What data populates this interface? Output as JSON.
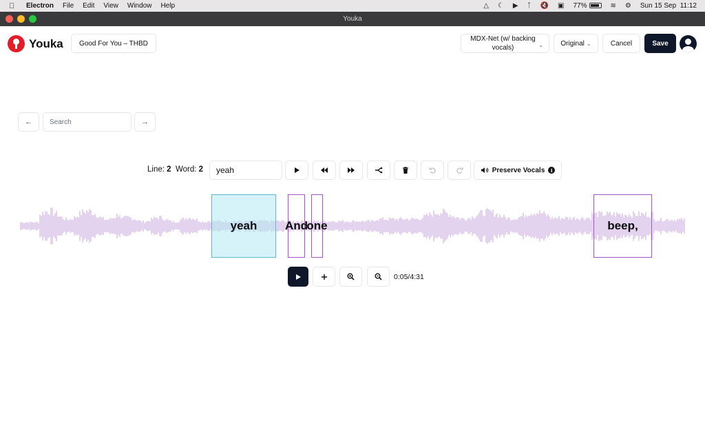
{
  "menubar": {
    "app_name": "Electron",
    "items": [
      "File",
      "Edit",
      "View",
      "Window",
      "Help"
    ],
    "battery": "77%",
    "date": "Sun 15 Sep",
    "time": "11:12"
  },
  "window": {
    "title": "Youka"
  },
  "header": {
    "logo_text": "Youka",
    "song": "Good For You – THBD",
    "model_select": "MDX-Net (w/ backing vocals)",
    "audio_select": "Original",
    "cancel_label": "Cancel",
    "save_label": "Save"
  },
  "search": {
    "placeholder": "Search"
  },
  "editor": {
    "line_label": "Line:",
    "line_value": "2",
    "word_label": "Word:",
    "word_value": "2",
    "word_text": "yeah",
    "preserve_label": "Preserve Vocals"
  },
  "waveform": {
    "color": "#c9a7dc",
    "words": [
      {
        "text": "yeah",
        "active": true
      },
      {
        "text": "And",
        "active": false
      },
      {
        "text": "one",
        "active": false
      },
      {
        "text": "beep,",
        "active": false
      }
    ]
  },
  "player": {
    "time": "0:05/4:31"
  },
  "colors": {
    "accent": "#0f172a",
    "brand": "#e11d2a",
    "word_border": "#a855c7",
    "active_word": "#b2e9f3"
  }
}
